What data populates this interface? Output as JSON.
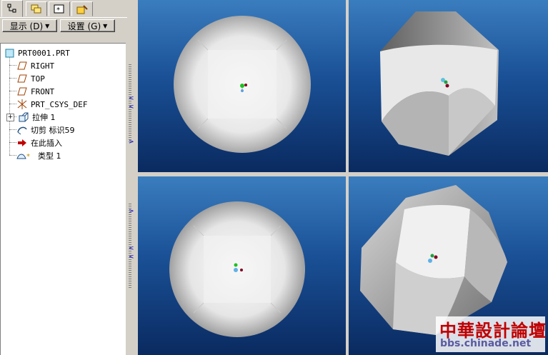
{
  "toolbar": {
    "tabs": [
      {
        "icon": "model-tree-icon"
      },
      {
        "icon": "layers-icon"
      },
      {
        "icon": "star-frame-icon"
      },
      {
        "icon": "favorites-icon"
      }
    ],
    "display_label": "显示 (D)",
    "settings_label": "设置 (G)"
  },
  "tree": {
    "root": "PRT0001.PRT",
    "items": [
      {
        "label": "RIGHT",
        "icon": "datum-plane-icon"
      },
      {
        "label": "TOP",
        "icon": "datum-plane-icon"
      },
      {
        "label": "FRONT",
        "icon": "datum-plane-icon"
      },
      {
        "label": "PRT_CSYS_DEF",
        "icon": "csys-icon"
      },
      {
        "label": "拉伸 1",
        "icon": "extrude-icon"
      },
      {
        "label": "切剪 标识59",
        "icon": "cut-icon"
      },
      {
        "label": "在此插入",
        "icon": "insert-here-arrow-icon"
      },
      {
        "label": "类型 1",
        "icon": "surface-type-icon"
      }
    ]
  },
  "colors": {
    "viewport_top": "#3a7dbe",
    "viewport_bottom": "#0a2a60",
    "insert_arrow": "#c00000"
  },
  "watermark": {
    "title": "中華設計論壇",
    "url": "bbs.chinade.net"
  }
}
